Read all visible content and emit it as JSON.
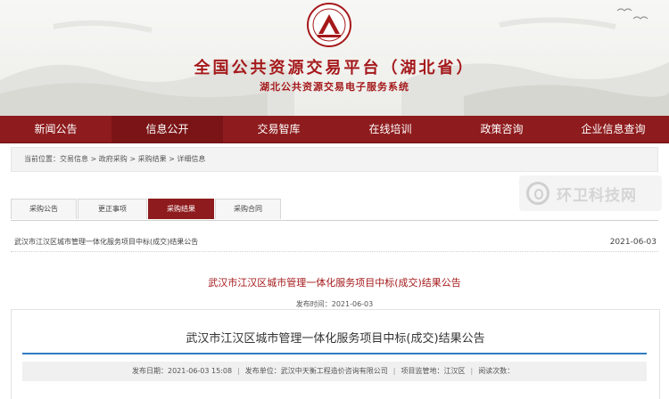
{
  "header": {
    "site_title": "全国公共资源交易平台（湖北省）",
    "site_subtitle": "湖北公共资源交易电子服务系统",
    "emblem_icon": "emblem-icon",
    "brand_color": "#a5191b"
  },
  "nav": {
    "items": [
      {
        "label": "新闻公告"
      },
      {
        "label": "信息公开"
      },
      {
        "label": "交易智库"
      },
      {
        "label": "在线培训"
      },
      {
        "label": "政策咨询"
      },
      {
        "label": "企业信息查询"
      }
    ],
    "active_index": 1,
    "color": "#8e1b1d"
  },
  "breadcrumb": {
    "text": "当前位置：交易信息 > 政府采购 > 采购结果 > 详细信息"
  },
  "watermark": {
    "text": "环卫科技网"
  },
  "tabs": {
    "items": [
      {
        "label": "采购公告"
      },
      {
        "label": "更正事项"
      },
      {
        "label": "采购结果"
      },
      {
        "label": "采购合同"
      }
    ],
    "active_index": 2
  },
  "list": {
    "title": "武汉市江汉区城市管理一体化服务项目中标(成交)结果公告",
    "date": "2021-06-03"
  },
  "detail": {
    "title": "武汉市江汉区城市管理一体化服务项目中标(成交)结果公告",
    "publish_time": "发布时间：2021-06-03"
  },
  "panel": {
    "title": "武汉市江汉区城市管理一体化服务项目中标(成交)结果公告",
    "meta": {
      "publish_date": "发布日期：2021-06-03 15:08",
      "publisher": "发布单位：武汉中天衡工程造价咨询有限公司",
      "supervision": "项目监管地：江汉区",
      "reads": "阅读次数："
    },
    "accent_color": "#2f7bc2"
  }
}
